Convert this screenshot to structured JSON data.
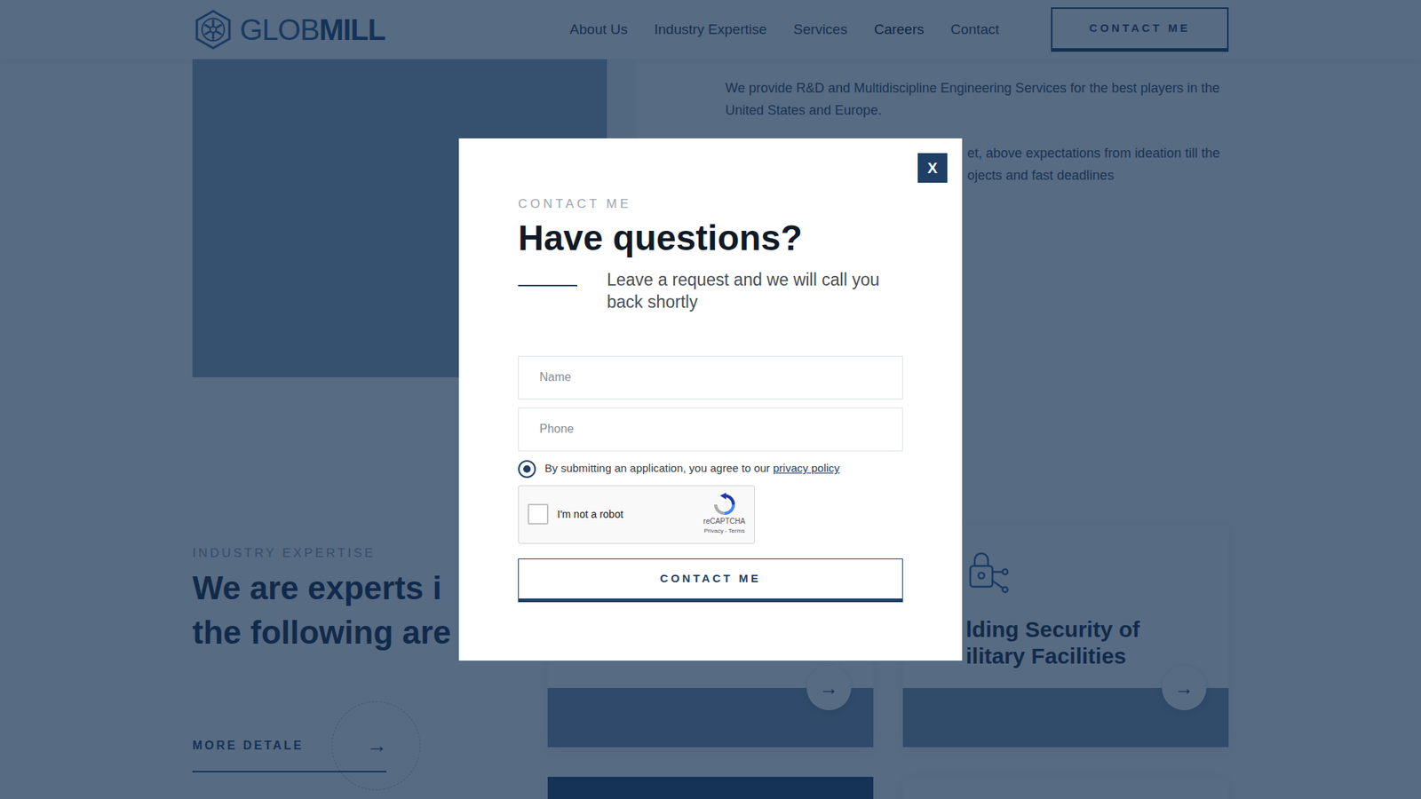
{
  "header": {
    "logo": {
      "light": "GLOB",
      "bold": "MILL"
    },
    "nav": [
      {
        "label": "About Us",
        "selected": false
      },
      {
        "label": "Industry Expertise",
        "selected": false
      },
      {
        "label": "Services",
        "selected": false
      },
      {
        "label": "Careers",
        "selected": true
      },
      {
        "label": "Contact",
        "selected": false
      }
    ],
    "button": "CONTACT ME"
  },
  "intro": {
    "paragraph": "We provide R&D and Multidiscipline Engineering Services for the best players in the United States and Europe.",
    "partial_lines": [
      "et, above expectations from ideation till the",
      "ojects and fast deadlines"
    ]
  },
  "expertise": {
    "label": "INDUSTRY EXPERTISE",
    "heading_lines": [
      "We are experts i",
      "the following are"
    ],
    "more": {
      "label": "MORE DETALE",
      "arrow": "→"
    },
    "cards": [
      {
        "arrow": "→"
      },
      {
        "title_lines": [
          "lding Security of",
          "ilitary Facilities"
        ],
        "arrow": "→"
      }
    ]
  },
  "modal": {
    "close": "X",
    "label": "CONTACT ME",
    "title": "Have questions?",
    "subtitle": "Leave a request and we will call you back shortly",
    "fields": [
      {
        "placeholder": "Name"
      },
      {
        "placeholder": "Phone"
      }
    ],
    "consent": {
      "checked": true,
      "text": "By submitting an application, you agree to our",
      "link": "privacy policy"
    },
    "captcha": {
      "checked": false,
      "label": "I'm not a robot",
      "brand": "reCAPTCHA",
      "links": "Privacy - Terms"
    },
    "submit": "CONTACT ME"
  }
}
